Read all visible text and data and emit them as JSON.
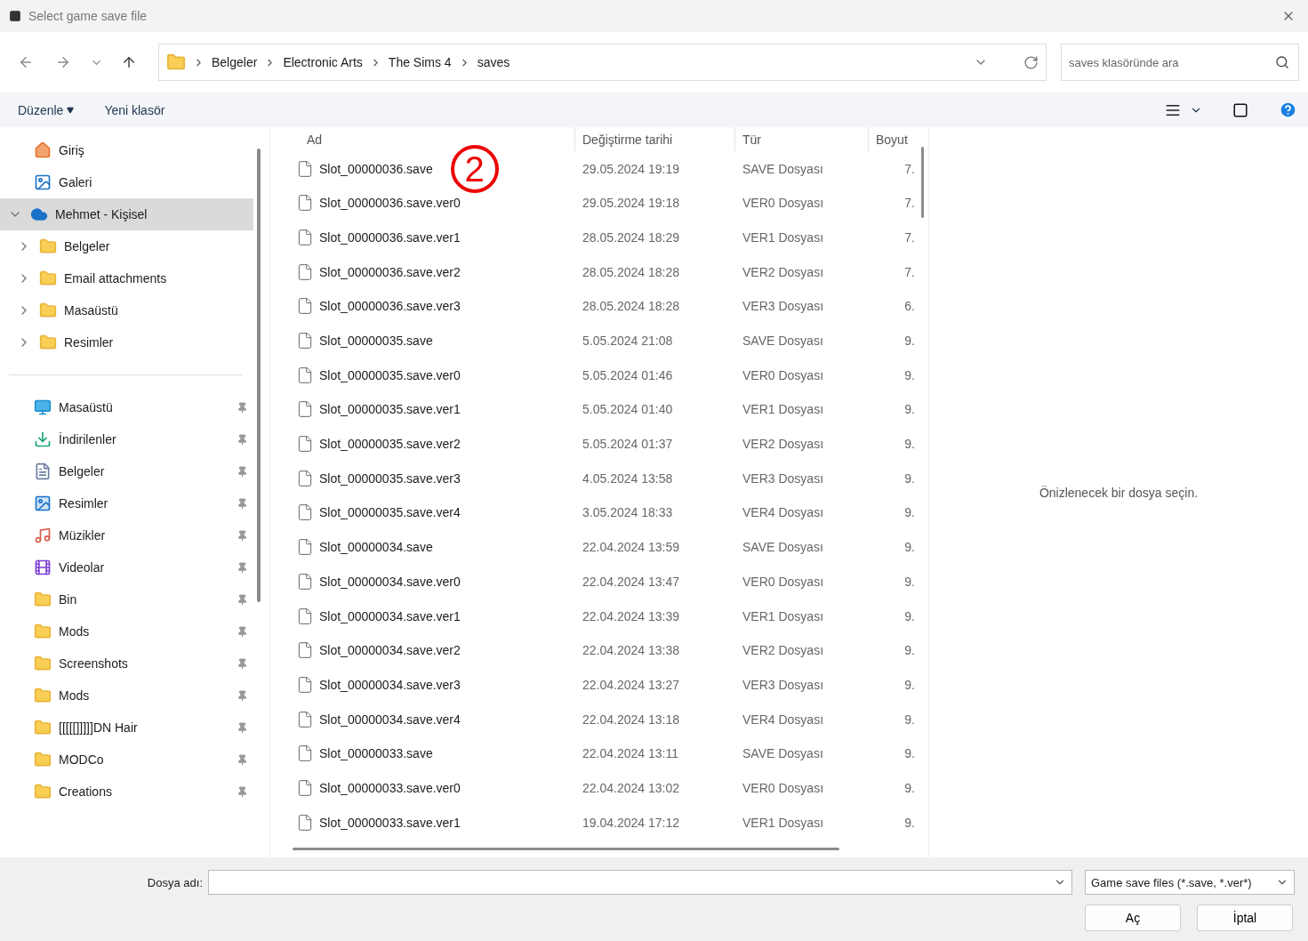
{
  "window": {
    "title": "Select game save file"
  },
  "breadcrumb": [
    "Belgeler",
    "Electronic Arts",
    "The Sims 4",
    "saves"
  ],
  "search": {
    "placeholder": "saves klasöründe ara"
  },
  "commands": {
    "organize": "Düzenle",
    "new_folder": "Yeni klasör"
  },
  "sidebar": {
    "top": [
      {
        "label": "Giriş",
        "kind": "home",
        "selected": false
      },
      {
        "label": "Galeri",
        "kind": "gallery",
        "selected": false
      },
      {
        "label": "Mehmet - Kişisel",
        "kind": "cloud",
        "selected": true,
        "expanded": true,
        "children": [
          {
            "label": "Belgeler",
            "kind": "folder",
            "selected": false,
            "expanded": false
          },
          {
            "label": "Email attachments",
            "kind": "folder",
            "selected": false,
            "expanded": false
          },
          {
            "label": "Masaüstü",
            "kind": "folder",
            "selected": false,
            "expanded": false
          },
          {
            "label": "Resimler",
            "kind": "folder",
            "selected": false,
            "expanded": false
          }
        ]
      }
    ],
    "pinned": [
      {
        "label": "Masaüstü",
        "kind": "desktop",
        "selected": false
      },
      {
        "label": "İndirilenler",
        "kind": "download",
        "selected": false
      },
      {
        "label": "Belgeler",
        "kind": "document",
        "selected": false
      },
      {
        "label": "Resimler",
        "kind": "picture",
        "selected": false
      },
      {
        "label": "Müzikler",
        "kind": "music",
        "selected": false
      },
      {
        "label": "Videolar",
        "kind": "video",
        "selected": false
      },
      {
        "label": "Bin",
        "kind": "folder",
        "selected": false
      },
      {
        "label": "Mods",
        "kind": "folder",
        "selected": false
      },
      {
        "label": "Screenshots",
        "kind": "folder",
        "selected": false
      },
      {
        "label": "Mods",
        "kind": "folder",
        "selected": false
      },
      {
        "label": "[[[[[]]]]]DN Hair",
        "kind": "folder",
        "selected": false
      },
      {
        "label": "MODCo",
        "kind": "folder",
        "selected": false
      },
      {
        "label": "Creations",
        "kind": "folder",
        "selected": false
      }
    ]
  },
  "table": {
    "columns": [
      "Ad",
      "Değiştirme tarihi",
      "Tür",
      "Boyut"
    ],
    "rows": [
      [
        "Slot_00000036.save",
        "29.05.2024 19:19",
        "SAVE Dosyası",
        "7."
      ],
      [
        "Slot_00000036.save.ver0",
        "29.05.2024 19:18",
        "VER0 Dosyası",
        "7."
      ],
      [
        "Slot_00000036.save.ver1",
        "28.05.2024 18:29",
        "VER1 Dosyası",
        "7."
      ],
      [
        "Slot_00000036.save.ver2",
        "28.05.2024 18:28",
        "VER2 Dosyası",
        "7."
      ],
      [
        "Slot_00000036.save.ver3",
        "28.05.2024 18:28",
        "VER3 Dosyası",
        "6."
      ],
      [
        "Slot_00000035.save",
        "5.05.2024 21:08",
        "SAVE Dosyası",
        "9."
      ],
      [
        "Slot_00000035.save.ver0",
        "5.05.2024 01:46",
        "VER0 Dosyası",
        "9."
      ],
      [
        "Slot_00000035.save.ver1",
        "5.05.2024 01:40",
        "VER1 Dosyası",
        "9."
      ],
      [
        "Slot_00000035.save.ver2",
        "5.05.2024 01:37",
        "VER2 Dosyası",
        "9."
      ],
      [
        "Slot_00000035.save.ver3",
        "4.05.2024 13:58",
        "VER3 Dosyası",
        "9."
      ],
      [
        "Slot_00000035.save.ver4",
        "3.05.2024 18:33",
        "VER4 Dosyası",
        "9."
      ],
      [
        "Slot_00000034.save",
        "22.04.2024 13:59",
        "SAVE Dosyası",
        "9."
      ],
      [
        "Slot_00000034.save.ver0",
        "22.04.2024 13:47",
        "VER0 Dosyası",
        "9."
      ],
      [
        "Slot_00000034.save.ver1",
        "22.04.2024 13:39",
        "VER1 Dosyası",
        "9."
      ],
      [
        "Slot_00000034.save.ver2",
        "22.04.2024 13:38",
        "VER2 Dosyası",
        "9."
      ],
      [
        "Slot_00000034.save.ver3",
        "22.04.2024 13:27",
        "VER3 Dosyası",
        "9."
      ],
      [
        "Slot_00000034.save.ver4",
        "22.04.2024 13:18",
        "VER4 Dosyası",
        "9."
      ],
      [
        "Slot_00000033.save",
        "22.04.2024 13:11",
        "SAVE Dosyası",
        "9."
      ],
      [
        "Slot_00000033.save.ver0",
        "22.04.2024 13:02",
        "VER0 Dosyası",
        "9."
      ],
      [
        "Slot_00000033.save.ver1",
        "19.04.2024 17:12",
        "VER1 Dosyası",
        "9."
      ]
    ]
  },
  "annotation": {
    "label": "2"
  },
  "preview": {
    "message": "Önizlenecek bir dosya seçin."
  },
  "footer": {
    "filename_label": "Dosya adı:",
    "filter": "Game save files (*.save, *.ver*)",
    "buttons": [
      "Aç",
      "İptal"
    ]
  }
}
